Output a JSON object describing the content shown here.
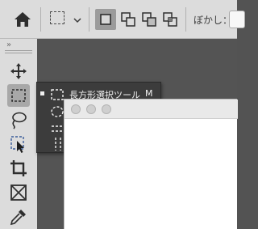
{
  "options_bar": {
    "home_icon": "home-icon",
    "tool_preset_icon": "rect-marquee-icon",
    "tool_preset_chevron": "chevron-down-icon",
    "selection_modes": [
      {
        "icon": "new-selection-icon",
        "active": true
      },
      {
        "icon": "add-to-selection-icon",
        "active": false
      },
      {
        "icon": "subtract-from-selection-icon",
        "active": false
      },
      {
        "icon": "intersect-selection-icon",
        "active": false
      }
    ],
    "feather_label": "ぼかし：",
    "feather_value": ""
  },
  "toolbar": {
    "grip": "»",
    "tools": [
      {
        "icon": "move-icon",
        "active": false
      },
      {
        "icon": "rect-marquee-icon",
        "active": true
      },
      {
        "icon": "lasso-icon",
        "active": false
      },
      {
        "icon": "object-select-icon",
        "active": false
      },
      {
        "icon": "crop-icon",
        "active": false
      },
      {
        "icon": "frame-icon",
        "active": false
      },
      {
        "icon": "eyedropper-icon",
        "active": false
      }
    ]
  },
  "flyout": {
    "items": [
      {
        "label": "長方形選択ツール",
        "shortcut": "M",
        "selected": true,
        "icon": "rect-marquee-icon"
      },
      {
        "label": "",
        "shortcut": "",
        "selected": false,
        "icon": "ellipse-marquee-icon"
      },
      {
        "label": "",
        "shortcut": "",
        "selected": false,
        "icon": "single-row-marquee-icon"
      },
      {
        "label": "",
        "shortcut": "",
        "selected": false,
        "icon": "single-column-marquee-icon"
      }
    ]
  },
  "document_window": {
    "traffic_lights": [
      "close",
      "minimize",
      "zoom"
    ]
  },
  "colors": {
    "panel_bg": "#dcdcdc",
    "workspace_bg": "#545454",
    "flyout_bg": "#3c3c3c",
    "active_tool_bg": "#a8a8a8"
  }
}
